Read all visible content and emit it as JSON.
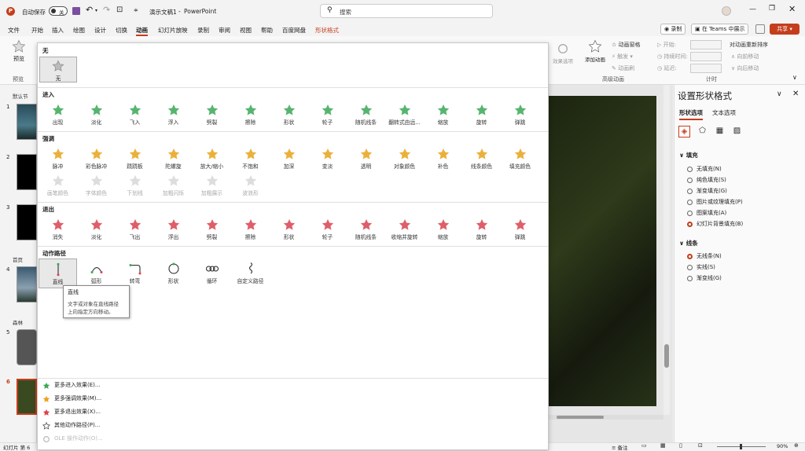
{
  "titlebar": {
    "autosave_label": "自动保存",
    "autosave_state": "关",
    "doc_title": "演示文稿1",
    "separator": "-",
    "app_name": "PowerPoint",
    "search_placeholder": "搜索"
  },
  "menu": [
    "文件",
    "开始",
    "插入",
    "绘图",
    "设计",
    "切换",
    "动画",
    "幻灯片放映",
    "录制",
    "审阅",
    "视图",
    "帮助",
    "百度网盘",
    "形状格式"
  ],
  "menu_active": "动画",
  "menu_context": "形状格式",
  "header_right": {
    "record": "录制",
    "teams": "在 Teams 中展示",
    "share": "共享"
  },
  "ribbon": {
    "preview": "预览",
    "preview_group": "预览",
    "effect_options": "效果选项",
    "add_animation": "添加动画",
    "animation_pane": "动画窗格",
    "trigger": "触发",
    "animation_painter": "动画刷",
    "advanced_group": "高级动画",
    "start": "开始:",
    "duration": "持续时间:",
    "delay": "延迟:",
    "reorder": "对动画重新排序",
    "move_earlier": "向前移动",
    "move_later": "向后移动",
    "timing_group": "计时"
  },
  "gallery": {
    "none_section": "无",
    "none_item": "无",
    "sections": [
      {
        "title": "进入",
        "color": "#3aa856",
        "rows": [
          [
            "出现",
            "淡化",
            "飞入",
            "浮入",
            "劈裂",
            "擦除",
            "形状",
            "轮子",
            "随机线条",
            "翻转式由远...",
            "缩放",
            "旋转",
            "弹跳"
          ]
        ]
      },
      {
        "title": "强调",
        "color": "#e8a31a",
        "rows": [
          [
            "脉冲",
            "彩色脉冲",
            "跷跷板",
            "陀螺旋",
            "放大/缩小",
            "不饱和",
            "加深",
            "变淡",
            "透明",
            "对象颜色",
            "补色",
            "线条颜色",
            "填充颜色"
          ],
          [
            "画笔颜色",
            "字体颜色",
            "下划线",
            "加粗闪烁",
            "加粗展示",
            "波浪形"
          ]
        ]
      },
      {
        "title": "退出",
        "color": "#d9434f",
        "rows": [
          [
            "消失",
            "淡化",
            "飞出",
            "浮出",
            "劈裂",
            "擦除",
            "形状",
            "轮子",
            "随机线条",
            "收缩并旋转",
            "缩放",
            "旋转",
            "弹跳"
          ]
        ]
      },
      {
        "title": "动作路径",
        "color": "#555555",
        "rows": [
          [
            "直线",
            "弧形",
            "转弯",
            "形状",
            "循环",
            "自定义路径"
          ]
        ]
      }
    ],
    "tooltip_title": "直线",
    "tooltip_line1": "文字或对象在直线路径",
    "tooltip_line2": "上向指定方向移动。",
    "more": [
      {
        "label": "更多进入效果(E)...",
        "color": "#3aa856",
        "disabled": false
      },
      {
        "label": "更多强调效果(M)...",
        "color": "#e8a31a",
        "disabled": false
      },
      {
        "label": "更多退出效果(X)...",
        "color": "#d9434f",
        "disabled": false
      },
      {
        "label": "其他动作路径(P)...",
        "color": "#555555",
        "disabled": false
      },
      {
        "label": "OLE 操作动作(O)...",
        "color": "#bbbbbb",
        "disabled": true
      }
    ]
  },
  "thumbs": {
    "sections": [
      "默认节",
      "首页",
      "森林"
    ],
    "numbers": [
      "1",
      "2",
      "3",
      "4",
      "5",
      "6"
    ]
  },
  "format_pane": {
    "title": "设置形状格式",
    "tab_shape": "形状选项",
    "tab_text": "文本选项",
    "fill_header": "填充",
    "fill_options": [
      "无填充(N)",
      "纯色填充(S)",
      "渐变填充(G)",
      "图片或纹理填充(P)",
      "图案填充(A)",
      "幻灯片背景填充(B)"
    ],
    "fill_selected": 5,
    "line_header": "线条",
    "line_options": [
      "无线条(N)",
      "实线(S)",
      "渐变线(G)"
    ],
    "line_selected": 0
  },
  "status": {
    "slide_info": "幻灯片 第 6",
    "notes": "备注",
    "zoom": "90%"
  },
  "colors": {
    "accent": "#c43e1c",
    "share_bg": "#c43e1c"
  }
}
